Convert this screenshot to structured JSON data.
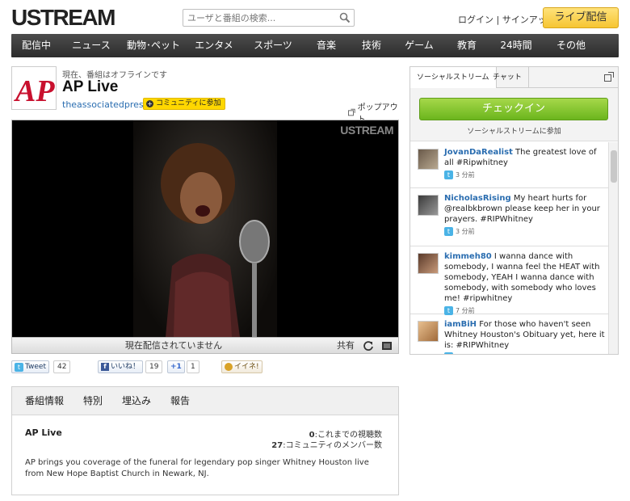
{
  "header": {
    "logo": "USTREAM",
    "search_placeholder": "ユーザと番組の検索...",
    "login": "ログイン",
    "separator": "|",
    "signup": "サインアップ",
    "broadcast": "ライブ配信"
  },
  "nav": {
    "items": [
      "配信中",
      "ニュース",
      "動物･ペット",
      "エンタメ",
      "スポーツ",
      "音楽",
      "技術",
      "ゲーム",
      "教育",
      "24時間",
      "その他"
    ]
  },
  "channel": {
    "status": "現在、番組はオフラインです",
    "title": "AP Live",
    "owner": "theassociatedpress",
    "join_label": "コミュニティに参加",
    "popout": "ポップアウト",
    "logo_text": "AP"
  },
  "player": {
    "watermark": "USTREAM",
    "offline_text": "現在配信されていません",
    "share": "共有"
  },
  "social": {
    "tweet_label": "Tweet",
    "tweet_count": "42",
    "like_label": "いいね！",
    "like_count": "19",
    "plus_label": "+1",
    "plus_count": "1",
    "mixi_label": "イイネ!"
  },
  "info": {
    "tabs": [
      "番組情報",
      "特別",
      "埋込み",
      "報告"
    ],
    "title": "AP Live",
    "views_count": "0",
    "views_label": ":これまでの視聴数",
    "members_count": "27",
    "members_label": ":コミュニティのメンバー数",
    "description": "AP brings you coverage of the funeral for legendary pop singer Whitney Houston live from New Hope Baptist Church in Newark, NJ."
  },
  "sidebar": {
    "tab_social": "ソーシャルストリーム",
    "tab_chat": "チャット",
    "checkin": "チェックイン",
    "join_stream": "ソーシャルストリームに参加",
    "tweets": [
      {
        "user": "JovanDaRealist",
        "text": " The greatest love of all #Ripwhitney",
        "time": "3 分前"
      },
      {
        "user": "NicholasRising",
        "text": " My heart hurts for @realbkbrown please keep her in your prayers. #RIPWhitney",
        "time": "3 分前"
      },
      {
        "user": "kimmeh80",
        "text": " I wanna dance with somebody, I wanna feel the HEAT with somebody, YEAH I wanna dance with somebody, with somebody who loves me! #ripwhitney",
        "time": "7 分前"
      },
      {
        "user": "iamBiH",
        "text": " For those who haven't seen Whitney Houston's Obituary yet, here it is: #RIPWhitney",
        "time": ""
      }
    ]
  },
  "colors": {
    "nav_bg": "#333333",
    "broadcast_btn": "#f6c532",
    "checkin_btn": "#7cc128",
    "link": "#2a6db0",
    "ap_red": "#c8102e"
  }
}
